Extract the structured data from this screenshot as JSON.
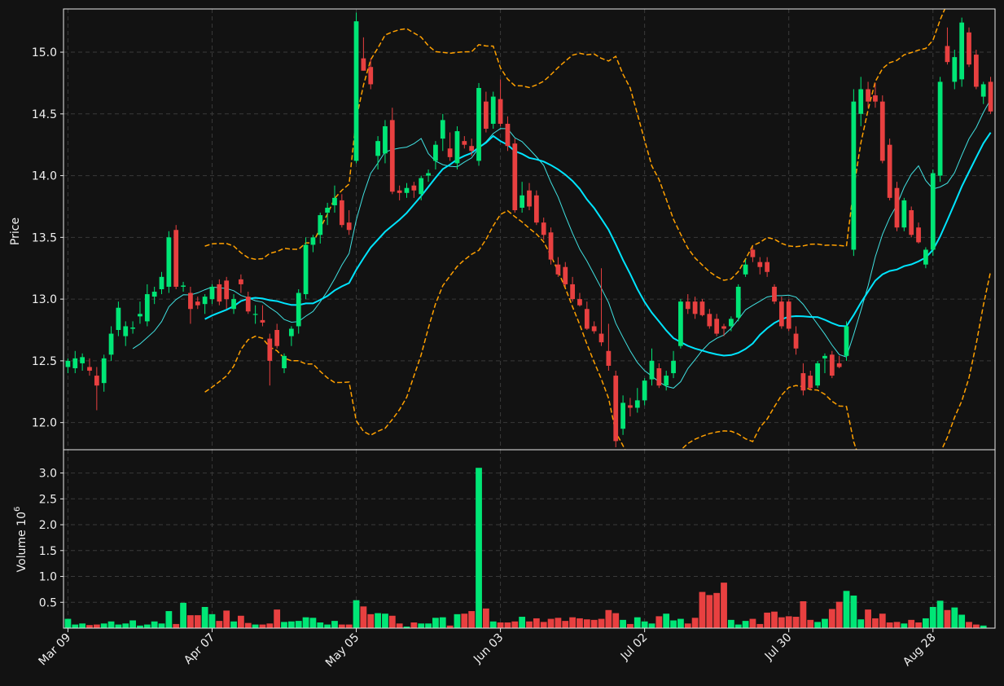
{
  "colors": {
    "background": "#121212",
    "frame": "#e8e8e8",
    "grid": "#3a3a3a",
    "up": "#00e676",
    "down": "#e84040",
    "ma_fast": "#40e0e0",
    "ma_slow": "#00e5ff",
    "band": "#ffa000"
  },
  "chart_data": [
    {
      "type": "candlestick",
      "ylabel": "Price",
      "ylim": [
        11.78,
        15.35
      ],
      "yticks": [
        "12.0",
        "12.5",
        "13.0",
        "13.5",
        "14.0",
        "14.5",
        "15.0"
      ],
      "grid": true,
      "x_tick_labels": [
        {
          "i": 0,
          "label": "Mar 09"
        },
        {
          "i": 20,
          "label": "Apr 07"
        },
        {
          "i": 40,
          "label": "May 05"
        },
        {
          "i": 60,
          "label": "Jun 03"
        },
        {
          "i": 80,
          "label": "Jul 02"
        },
        {
          "i": 100,
          "label": "Jul 30"
        },
        {
          "i": 120,
          "label": "Aug 28"
        }
      ],
      "ohlc": [
        [
          12.45,
          12.52,
          12.4,
          12.5
        ],
        [
          12.44,
          12.58,
          12.4,
          12.52
        ],
        [
          12.48,
          12.56,
          12.42,
          12.53
        ],
        [
          12.45,
          12.52,
          12.38,
          12.42
        ],
        [
          12.38,
          12.45,
          12.1,
          12.3
        ],
        [
          12.32,
          12.55,
          12.25,
          12.52
        ],
        [
          12.55,
          12.78,
          12.5,
          12.72
        ],
        [
          12.75,
          12.98,
          12.7,
          12.93
        ],
        [
          12.7,
          12.82,
          12.62,
          12.78
        ],
        [
          12.76,
          12.82,
          12.72,
          12.77
        ],
        [
          12.86,
          12.98,
          12.8,
          12.88
        ],
        [
          12.82,
          13.12,
          12.78,
          13.04
        ],
        [
          13.02,
          13.1,
          12.96,
          13.06
        ],
        [
          13.08,
          13.22,
          13.04,
          13.18
        ],
        [
          13.1,
          13.55,
          13.05,
          13.5
        ],
        [
          13.56,
          13.6,
          13.08,
          13.1
        ],
        [
          13.1,
          13.14,
          13.06,
          13.11
        ],
        [
          13.05,
          13.1,
          12.8,
          12.92
        ],
        [
          12.98,
          13.02,
          12.92,
          12.95
        ],
        [
          12.96,
          13.04,
          12.88,
          13.02
        ],
        [
          13.0,
          13.12,
          12.96,
          13.1
        ],
        [
          13.12,
          13.16,
          12.95,
          12.98
        ],
        [
          13.15,
          13.18,
          12.92,
          13.0
        ],
        [
          12.92,
          13.04,
          12.88,
          13.0
        ],
        [
          13.16,
          13.2,
          13.05,
          13.12
        ],
        [
          13.02,
          13.06,
          12.88,
          12.9
        ],
        [
          12.88,
          12.95,
          12.8,
          12.88
        ],
        [
          12.83,
          12.95,
          12.78,
          12.81
        ],
        [
          12.68,
          12.72,
          12.3,
          12.5
        ],
        [
          12.75,
          12.8,
          12.6,
          12.62
        ],
        [
          12.44,
          12.56,
          12.4,
          12.54
        ],
        [
          12.7,
          12.78,
          12.62,
          12.76
        ],
        [
          12.78,
          13.08,
          12.72,
          13.05
        ],
        [
          13.04,
          13.5,
          13.0,
          13.44
        ],
        [
          13.44,
          13.52,
          13.38,
          13.5
        ],
        [
          13.52,
          13.7,
          13.45,
          13.68
        ],
        [
          13.7,
          13.78,
          13.6,
          13.74
        ],
        [
          13.76,
          13.92,
          13.7,
          13.82
        ],
        [
          13.8,
          13.85,
          13.58,
          13.6
        ],
        [
          13.62,
          13.72,
          13.52,
          13.56
        ],
        [
          14.12,
          15.32,
          14.1,
          15.25
        ],
        [
          14.95,
          15.12,
          14.85,
          14.85
        ],
        [
          14.88,
          14.95,
          14.7,
          14.74
        ],
        [
          14.16,
          14.32,
          14.05,
          14.28
        ],
        [
          14.18,
          14.45,
          14.1,
          14.4
        ],
        [
          14.45,
          14.55,
          13.85,
          13.87
        ],
        [
          13.88,
          13.92,
          13.8,
          13.86
        ],
        [
          13.86,
          13.94,
          13.82,
          13.9
        ],
        [
          13.92,
          13.95,
          13.82,
          13.88
        ],
        [
          13.85,
          14.0,
          13.8,
          13.98
        ],
        [
          14.0,
          14.05,
          13.95,
          14.02
        ],
        [
          14.12,
          14.28,
          14.05,
          14.25
        ],
        [
          14.3,
          14.5,
          14.2,
          14.45
        ],
        [
          14.22,
          14.35,
          14.12,
          14.15
        ],
        [
          14.1,
          14.4,
          14.05,
          14.36
        ],
        [
          14.28,
          14.32,
          14.22,
          14.25
        ],
        [
          14.24,
          14.3,
          14.16,
          14.2
        ],
        [
          14.12,
          14.75,
          14.08,
          14.71
        ],
        [
          14.6,
          14.68,
          14.35,
          14.38
        ],
        [
          14.42,
          14.68,
          14.38,
          14.64
        ],
        [
          14.62,
          14.78,
          14.4,
          14.42
        ],
        [
          14.42,
          14.48,
          14.2,
          14.24
        ],
        [
          14.26,
          14.3,
          13.7,
          13.72
        ],
        [
          13.74,
          13.95,
          13.7,
          13.84
        ],
        [
          13.88,
          13.94,
          13.72,
          13.75
        ],
        [
          13.84,
          13.88,
          13.6,
          13.62
        ],
        [
          13.62,
          13.66,
          13.48,
          13.52
        ],
        [
          13.54,
          13.58,
          13.28,
          13.32
        ],
        [
          13.28,
          13.34,
          13.18,
          13.2
        ],
        [
          13.26,
          13.3,
          13.1,
          13.12
        ],
        [
          13.12,
          13.18,
          12.98,
          13.0
        ],
        [
          13.0,
          13.05,
          12.94,
          12.95
        ],
        [
          12.92,
          12.98,
          12.75,
          12.76
        ],
        [
          12.78,
          12.82,
          12.72,
          12.74
        ],
        [
          12.72,
          13.25,
          12.62,
          12.65
        ],
        [
          12.58,
          12.8,
          12.42,
          12.46
        ],
        [
          12.38,
          12.42,
          11.8,
          11.85
        ],
        [
          11.95,
          12.22,
          11.9,
          12.16
        ],
        [
          12.14,
          12.2,
          12.05,
          12.12
        ],
        [
          12.12,
          12.28,
          12.08,
          12.18
        ],
        [
          12.18,
          12.36,
          12.14,
          12.34
        ],
        [
          12.35,
          12.6,
          12.3,
          12.5
        ],
        [
          12.44,
          12.48,
          12.28,
          12.3
        ],
        [
          12.3,
          12.42,
          12.26,
          12.38
        ],
        [
          12.4,
          12.58,
          12.36,
          12.5
        ],
        [
          12.62,
          13.0,
          12.6,
          12.98
        ],
        [
          12.98,
          13.04,
          12.88,
          12.92
        ],
        [
          12.98,
          13.02,
          12.84,
          12.88
        ],
        [
          12.98,
          13.0,
          12.86,
          12.87
        ],
        [
          12.88,
          12.92,
          12.76,
          12.78
        ],
        [
          12.84,
          12.88,
          12.7,
          12.72
        ],
        [
          12.78,
          12.8,
          12.7,
          12.76
        ],
        [
          12.78,
          12.86,
          12.74,
          12.84
        ],
        [
          12.85,
          13.12,
          12.82,
          13.1
        ],
        [
          13.2,
          13.32,
          13.18,
          13.28
        ],
        [
          13.4,
          13.42,
          13.3,
          13.34
        ],
        [
          13.3,
          13.34,
          13.2,
          13.26
        ],
        [
          13.3,
          13.34,
          13.18,
          13.22
        ],
        [
          13.1,
          13.12,
          12.96,
          12.98
        ],
        [
          12.98,
          13.02,
          12.76,
          12.78
        ],
        [
          12.98,
          13.0,
          12.74,
          12.76
        ],
        [
          12.72,
          12.78,
          12.55,
          12.6
        ],
        [
          12.4,
          12.48,
          12.22,
          12.26
        ],
        [
          12.38,
          12.42,
          12.26,
          12.28
        ],
        [
          12.3,
          12.5,
          12.28,
          12.48
        ],
        [
          12.52,
          12.56,
          12.4,
          12.54
        ],
        [
          12.55,
          12.58,
          12.36,
          12.38
        ],
        [
          12.48,
          12.54,
          12.44,
          12.45
        ],
        [
          12.54,
          12.82,
          12.5,
          12.78
        ],
        [
          13.4,
          14.7,
          13.35,
          14.6
        ],
        [
          14.5,
          14.8,
          14.4,
          14.7
        ],
        [
          14.7,
          14.76,
          14.55,
          14.6
        ],
        [
          14.65,
          14.75,
          14.55,
          14.6
        ],
        [
          14.6,
          14.65,
          14.1,
          14.12
        ],
        [
          14.25,
          14.3,
          13.8,
          13.82
        ],
        [
          13.9,
          13.95,
          13.55,
          13.58
        ],
        [
          13.58,
          13.82,
          13.55,
          13.8
        ],
        [
          13.72,
          13.75,
          13.5,
          13.52
        ],
        [
          13.58,
          13.62,
          13.45,
          13.46
        ],
        [
          13.28,
          13.42,
          13.25,
          13.4
        ],
        [
          13.4,
          14.05,
          13.35,
          14.02
        ],
        [
          14.0,
          14.8,
          13.95,
          14.76
        ],
        [
          15.05,
          15.2,
          14.9,
          14.92
        ],
        [
          14.76,
          15.02,
          14.7,
          14.96
        ],
        [
          14.78,
          15.28,
          14.72,
          15.24
        ],
        [
          15.16,
          15.2,
          14.88,
          14.9
        ],
        [
          14.98,
          15.02,
          14.7,
          14.72
        ],
        [
          14.64,
          14.76,
          14.58,
          14.74
        ],
        [
          14.76,
          14.8,
          14.5,
          14.52
        ]
      ]
    },
    {
      "type": "bar",
      "ylabel": "Volume  10",
      "ylabel_exponent": "6",
      "ylim": [
        0,
        3.45
      ],
      "yticks": [
        "0.5",
        "1.0",
        "1.5",
        "2.0",
        "2.5",
        "3.0"
      ],
      "grid": true,
      "values": [
        0.18,
        0.07,
        0.09,
        0.06,
        0.07,
        0.09,
        0.13,
        0.07,
        0.09,
        0.15,
        0.05,
        0.07,
        0.13,
        0.09,
        0.33,
        0.08,
        0.49,
        0.25,
        0.25,
        0.41,
        0.27,
        0.14,
        0.34,
        0.13,
        0.24,
        0.1,
        0.07,
        0.07,
        0.09,
        0.36,
        0.12,
        0.13,
        0.14,
        0.21,
        0.2,
        0.11,
        0.07,
        0.14,
        0.07,
        0.07,
        0.54,
        0.42,
        0.27,
        0.29,
        0.28,
        0.24,
        0.09,
        0.03,
        0.11,
        0.09,
        0.09,
        0.2,
        0.21,
        0.05,
        0.27,
        0.28,
        0.33,
        3.1,
        0.38,
        0.13,
        0.11,
        0.11,
        0.13,
        0.22,
        0.13,
        0.19,
        0.12,
        0.18,
        0.2,
        0.14,
        0.21,
        0.19,
        0.17,
        0.16,
        0.18,
        0.35,
        0.29,
        0.16,
        0.08,
        0.21,
        0.13,
        0.09,
        0.23,
        0.28,
        0.15,
        0.18,
        0.09,
        0.2,
        0.7,
        0.64,
        0.68,
        0.88,
        0.16,
        0.07,
        0.14,
        0.18,
        0.08,
        0.3,
        0.32,
        0.21,
        0.23,
        0.22,
        0.52,
        0.16,
        0.12,
        0.18,
        0.37,
        0.51,
        0.72,
        0.63,
        0.17,
        0.36,
        0.19,
        0.28,
        0.11,
        0.12,
        0.09,
        0.16,
        0.11,
        0.19,
        0.41,
        0.53,
        0.35,
        0.4,
        0.26,
        0.12,
        0.07,
        0.05
      ]
    }
  ]
}
